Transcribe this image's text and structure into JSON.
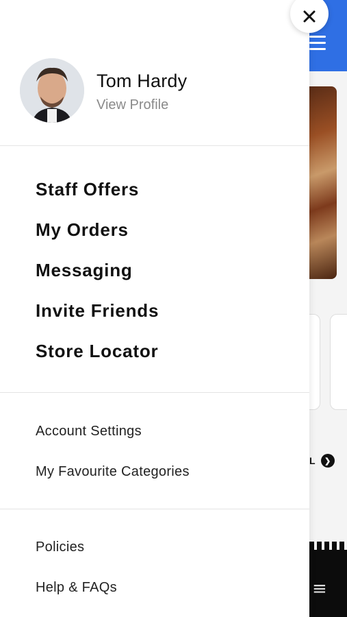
{
  "profile": {
    "name": "Tom Hardy",
    "link": "View Profile"
  },
  "main_menu": [
    "Staff Offers",
    "My Orders",
    "Messaging",
    "Invite Friends",
    "Store Locator"
  ],
  "secondary_menu": [
    "Account Settings",
    "My Favourite Categories"
  ],
  "tertiary_menu": [
    "Policies",
    "Help & FAQs"
  ],
  "background": {
    "view_all_fragment": "L"
  },
  "colors": {
    "accent": "#2f6fe4",
    "text_primary": "#111111",
    "text_muted": "#8a8a8a",
    "divider": "#e4e4e4"
  },
  "icons": {
    "close": "close-icon",
    "menu": "hamburger-icon",
    "arrow": "arrow-right-circle-icon"
  }
}
